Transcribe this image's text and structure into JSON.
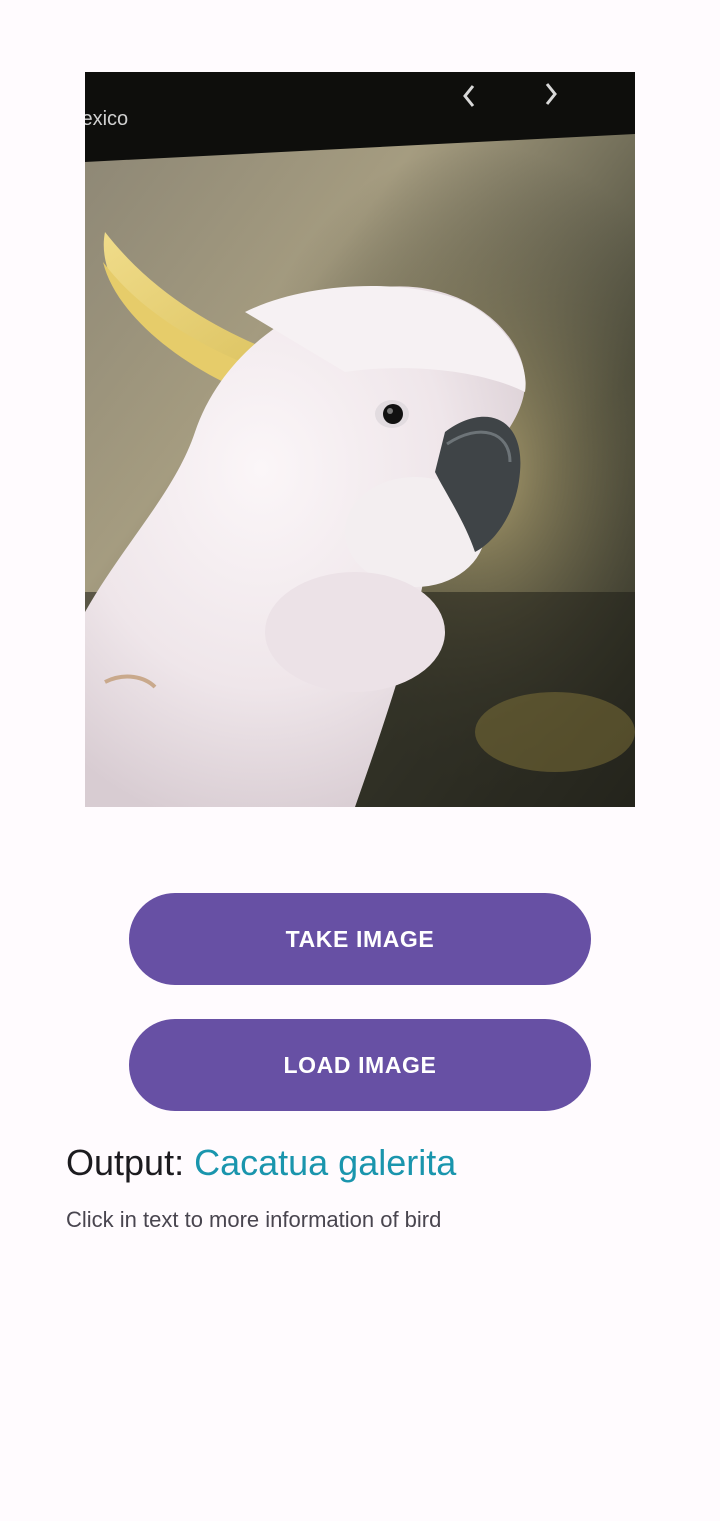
{
  "photo": {
    "overlay_caption": "lexico",
    "subject": "white cockatoo with yellow crest"
  },
  "buttons": {
    "take_image": "TAKE IMAGE",
    "load_image": "LOAD IMAGE"
  },
  "output": {
    "label": "Output: ",
    "value": "Cacatua galerita"
  },
  "hint": "Click in text to more information of bird",
  "colors": {
    "background": "#fffbfe",
    "button": "#6750a4",
    "output_value": "#1a95ad"
  },
  "icons": [
    "chevron-left-icon",
    "chevron-right-icon"
  ]
}
